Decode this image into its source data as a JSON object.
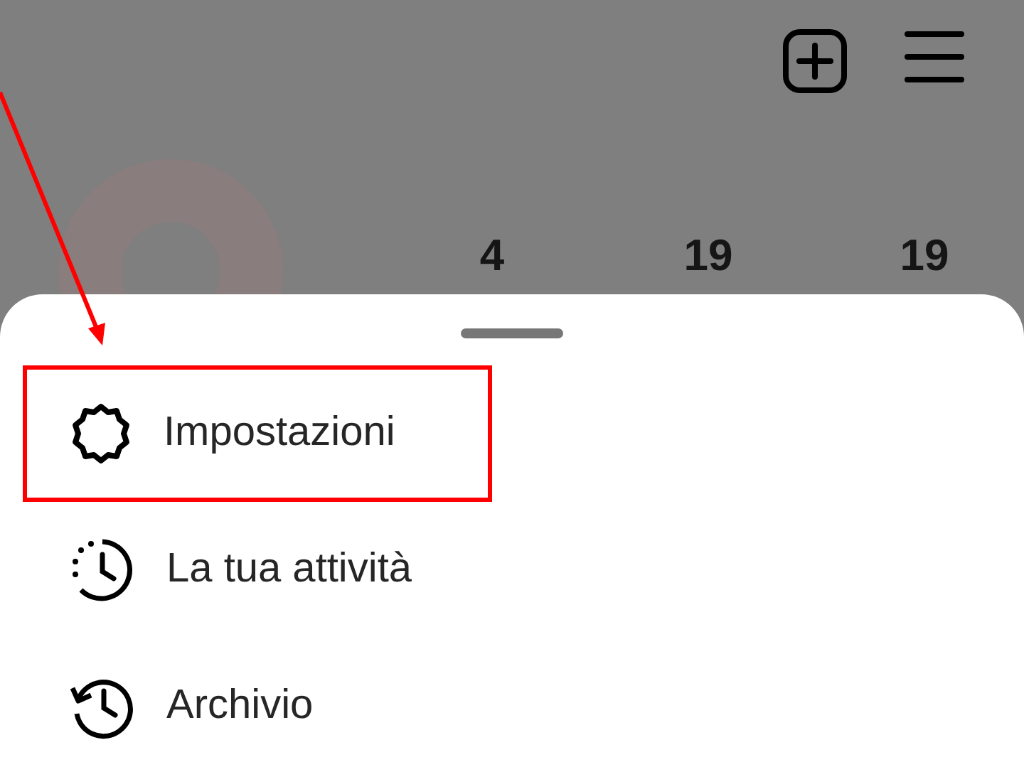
{
  "profile": {
    "stats": [
      "4",
      "19",
      "19"
    ]
  },
  "menu": [
    {
      "kind": "settings",
      "label": "Impostazioni",
      "highlighted": true
    },
    {
      "kind": "activity",
      "label": "La tua attività",
      "highlighted": false
    },
    {
      "kind": "archive",
      "label": "Archivio",
      "highlighted": false
    }
  ]
}
